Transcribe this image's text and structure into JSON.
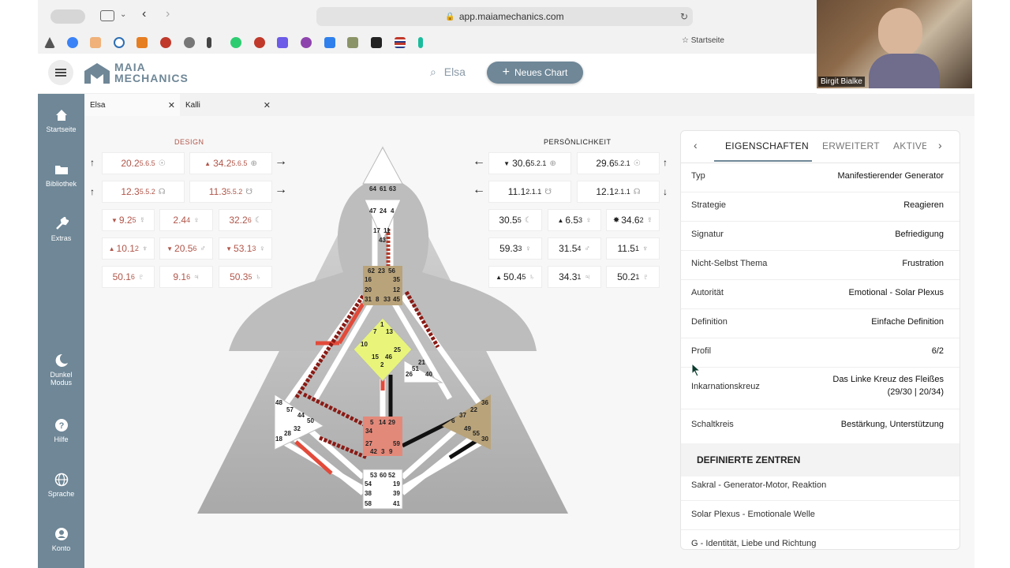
{
  "browser": {
    "url": "app.maiamechanics.com",
    "bookmark_label": "Startseite"
  },
  "webcam": {
    "name": "Birgit Bialke"
  },
  "app": {
    "logo_top": "MAIA",
    "logo_bottom": "MECHANICS",
    "search_value": "Elsa",
    "new_chart_label": "Neues Chart"
  },
  "nav": {
    "home": "Startseite",
    "library": "Bibliothek",
    "extras": "Extras",
    "dark_mode_1": "Dunkel",
    "dark_mode_2": "Modus",
    "help": "Hilfe",
    "language": "Sprache",
    "account": "Konto"
  },
  "tabs": [
    {
      "label": "Elsa"
    },
    {
      "label": "Kalli"
    }
  ],
  "design": {
    "title": "DESIGN",
    "rows": [
      [
        "20.2",
        "5.6.5",
        "34.2",
        "5.6.5"
      ],
      [
        "12.3",
        "5.5.2",
        "11.3",
        "5.5.2"
      ]
    ],
    "planets": [
      [
        "9.2",
        "5",
        "2.4",
        "4",
        "32.2",
        "6"
      ],
      [
        "10.1",
        "2",
        "20.5",
        "6",
        "53.1",
        "3"
      ],
      [
        "50.1",
        "6",
        "9.1",
        "6",
        "50.3",
        "5"
      ]
    ]
  },
  "personality": {
    "title": "PERSÖNLICHKEIT",
    "rows": [
      [
        "30.6",
        "5.2.1",
        "29.6",
        "5.2.1"
      ],
      [
        "11.1",
        "2.1.1",
        "12.1",
        "2.1.1"
      ]
    ],
    "planets": [
      [
        "30.5",
        "5",
        "6.5",
        "3",
        "34.6",
        "2"
      ],
      [
        "59.3",
        "3",
        "31.5",
        "4",
        "11.5",
        "1"
      ],
      [
        "50.4",
        "5",
        "34.3",
        "1",
        "50.2",
        "1"
      ]
    ]
  },
  "bodygraph": {
    "head": [
      "64",
      "61",
      "63"
    ],
    "ajna_top": [
      "47",
      "24",
      "4"
    ],
    "ajna_bottom": [
      "17",
      "11",
      "43"
    ],
    "throat": [
      "62",
      "23",
      "56",
      "16",
      "35",
      "20",
      "12",
      "31",
      "8",
      "33",
      "45"
    ],
    "g_center": [
      "1",
      "7",
      "13",
      "10",
      "25",
      "15",
      "46",
      "2"
    ],
    "ego": [
      "21",
      "51",
      "26",
      "40"
    ],
    "spleen": [
      "48",
      "57",
      "44",
      "50",
      "32",
      "28",
      "18"
    ],
    "solar": [
      "36",
      "22",
      "37",
      "6",
      "49",
      "55",
      "30"
    ],
    "sacral": [
      "5",
      "14",
      "29",
      "34",
      "27",
      "59",
      "42",
      "3",
      "9"
    ],
    "root": [
      "53",
      "60",
      "52",
      "54",
      "19",
      "38",
      "39",
      "58",
      "41"
    ]
  },
  "panel": {
    "tabs": [
      "EIGENSCHAFTEN",
      "ERWEITERT",
      "AKTIVE"
    ],
    "properties": [
      {
        "key": "Typ",
        "value": "Manifestierender Generator"
      },
      {
        "key": "Strategie",
        "value": "Reagieren"
      },
      {
        "key": "Signatur",
        "value": "Befriedigung"
      },
      {
        "key": "Nicht-Selbst Thema",
        "value": "Frustration"
      },
      {
        "key": "Autorität",
        "value": "Emotional - Solar Plexus"
      },
      {
        "key": "Definition",
        "value": "Einfache Definition"
      },
      {
        "key": "Profil",
        "value": "6/2"
      },
      {
        "key": "Inkarnationskreuz",
        "value": "Das Linke Kreuz des Fleißes",
        "value2": "(29/30 | 20/34)"
      },
      {
        "key": "Schaltkreis",
        "value": "Bestärkung, Unterstützung"
      }
    ],
    "centers_title": "DEFINIERTE ZENTREN",
    "centers": [
      "Sakral - Generator-Motor, Reaktion",
      "Solar Plexus - Emotionale Welle",
      "G - Identität, Liebe und Richtung"
    ]
  },
  "colors": {
    "accent": "#6f8797",
    "design_red": "#b0564a",
    "throat": "#b9a37a",
    "g_center": "#e8f57a",
    "sacral": "#e3897a",
    "solar": "#b9a37a"
  }
}
